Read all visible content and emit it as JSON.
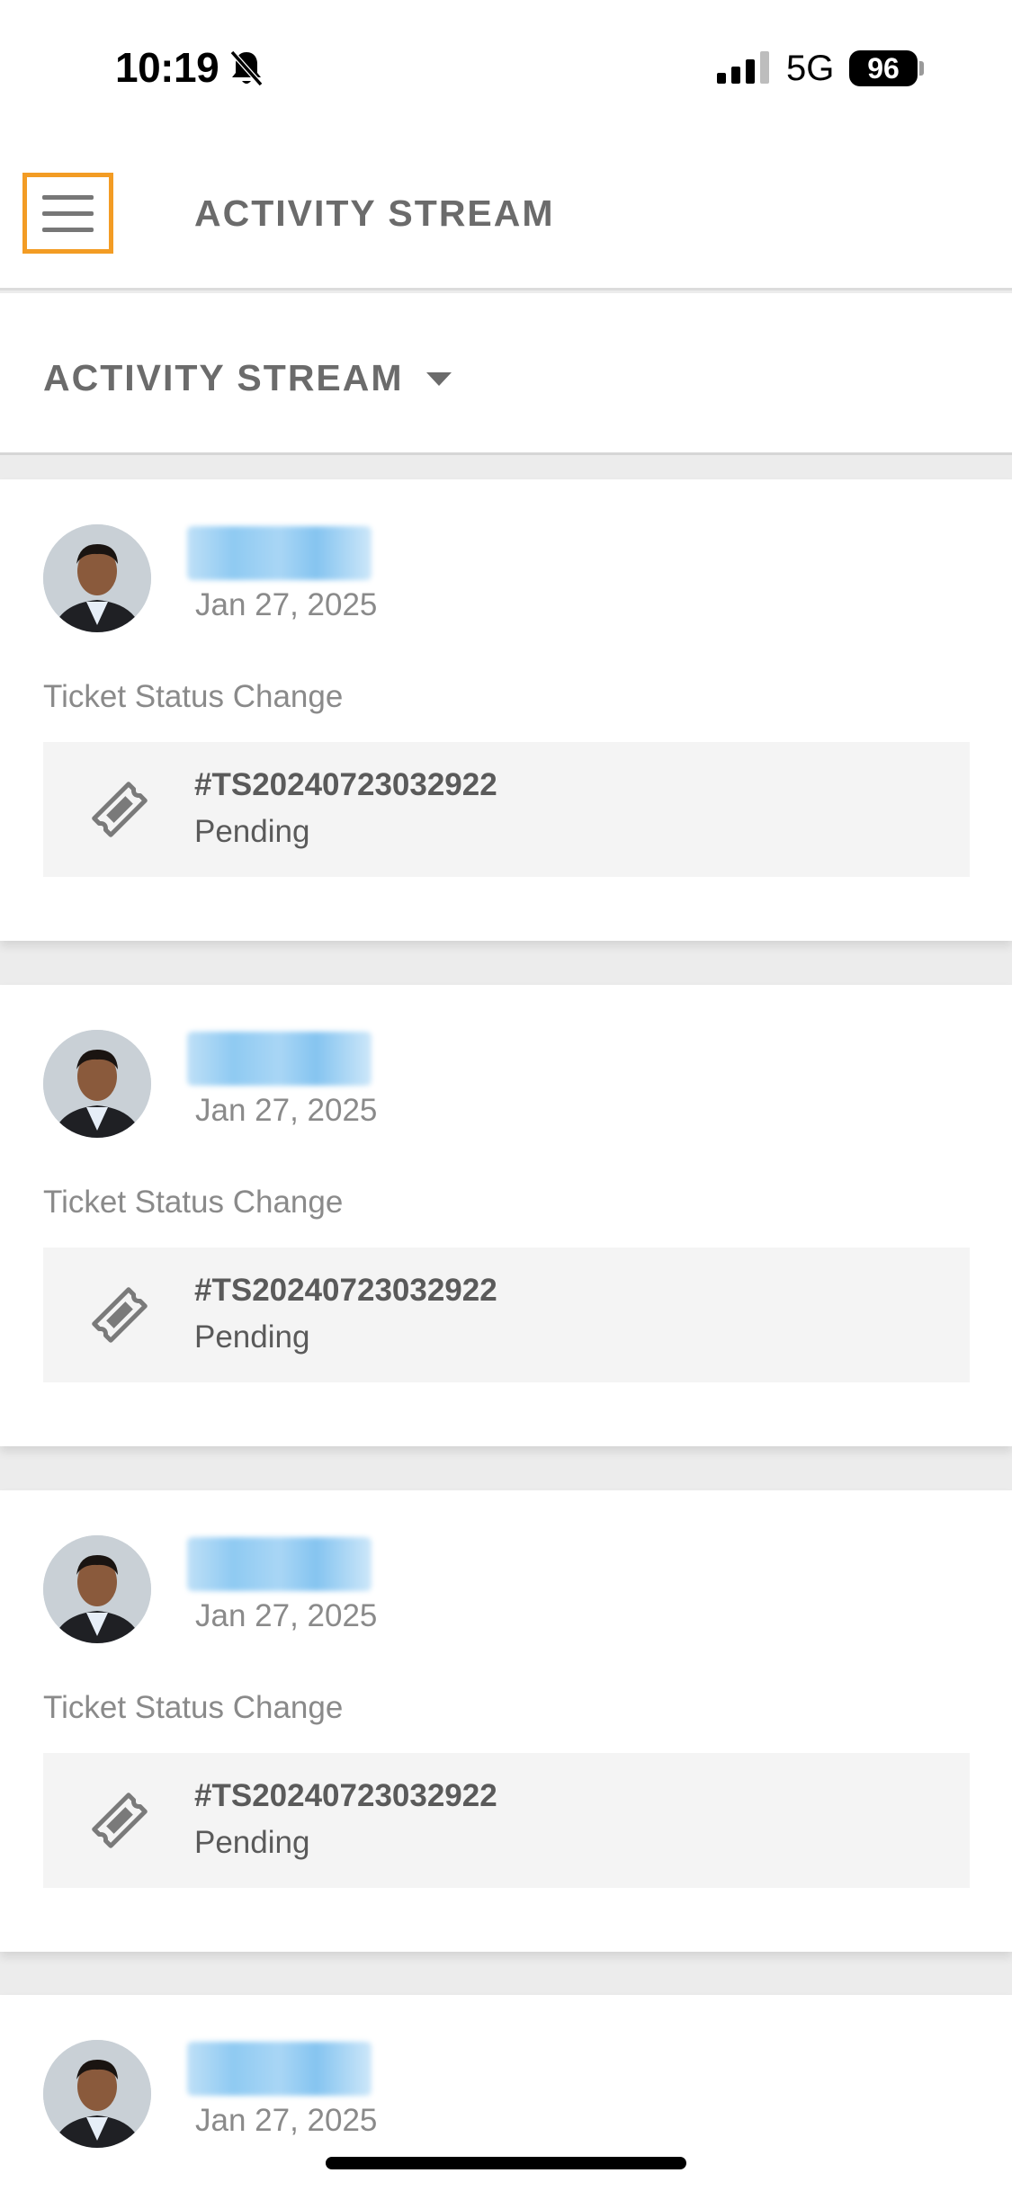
{
  "status_bar": {
    "time": "10:19",
    "network": "5G",
    "battery": "96",
    "icons": [
      "bell-slash-icon",
      "signal-icon",
      "battery-icon"
    ]
  },
  "header": {
    "title": "ACTIVITY STREAM",
    "menu_icon": "hamburger-menu-icon",
    "accent_color": "#f39c24"
  },
  "filter": {
    "label": "ACTIVITY STREAM",
    "caret_icon": "caret-down-icon"
  },
  "activities": [
    {
      "date": "Jan 27, 2025",
      "type": "Ticket Status Change",
      "ticket_id": "#TS20240723032922",
      "status": "Pending"
    },
    {
      "date": "Jan 27, 2025",
      "type": "Ticket Status Change",
      "ticket_id": "#TS20240723032922",
      "status": "Pending"
    },
    {
      "date": "Jan 27, 2025",
      "type": "Ticket Status Change",
      "ticket_id": "#TS20240723032922",
      "status": "Pending"
    },
    {
      "date": "Jan 27, 2025"
    }
  ]
}
